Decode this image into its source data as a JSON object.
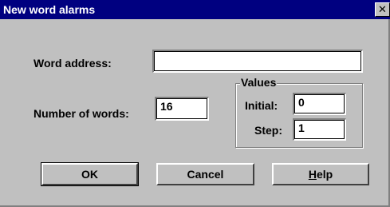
{
  "window": {
    "title": "New word alarms",
    "close_glyph": "✕",
    "close_icon": "close-icon"
  },
  "form": {
    "word_address": {
      "label": "Word address:",
      "value": ""
    },
    "number_of_words": {
      "label": "Number of words:",
      "value": "16"
    }
  },
  "values_group": {
    "legend": "Values",
    "initial": {
      "label": "Initial:",
      "value": "0"
    },
    "step": {
      "label": "Step:",
      "value": "1"
    }
  },
  "buttons": {
    "ok": "OK",
    "cancel": "Cancel",
    "help_mnemonic": "H",
    "help_rest": "elp"
  },
  "colors": {
    "titlebar": "#000080",
    "dialog_face": "#c0c0c0"
  }
}
